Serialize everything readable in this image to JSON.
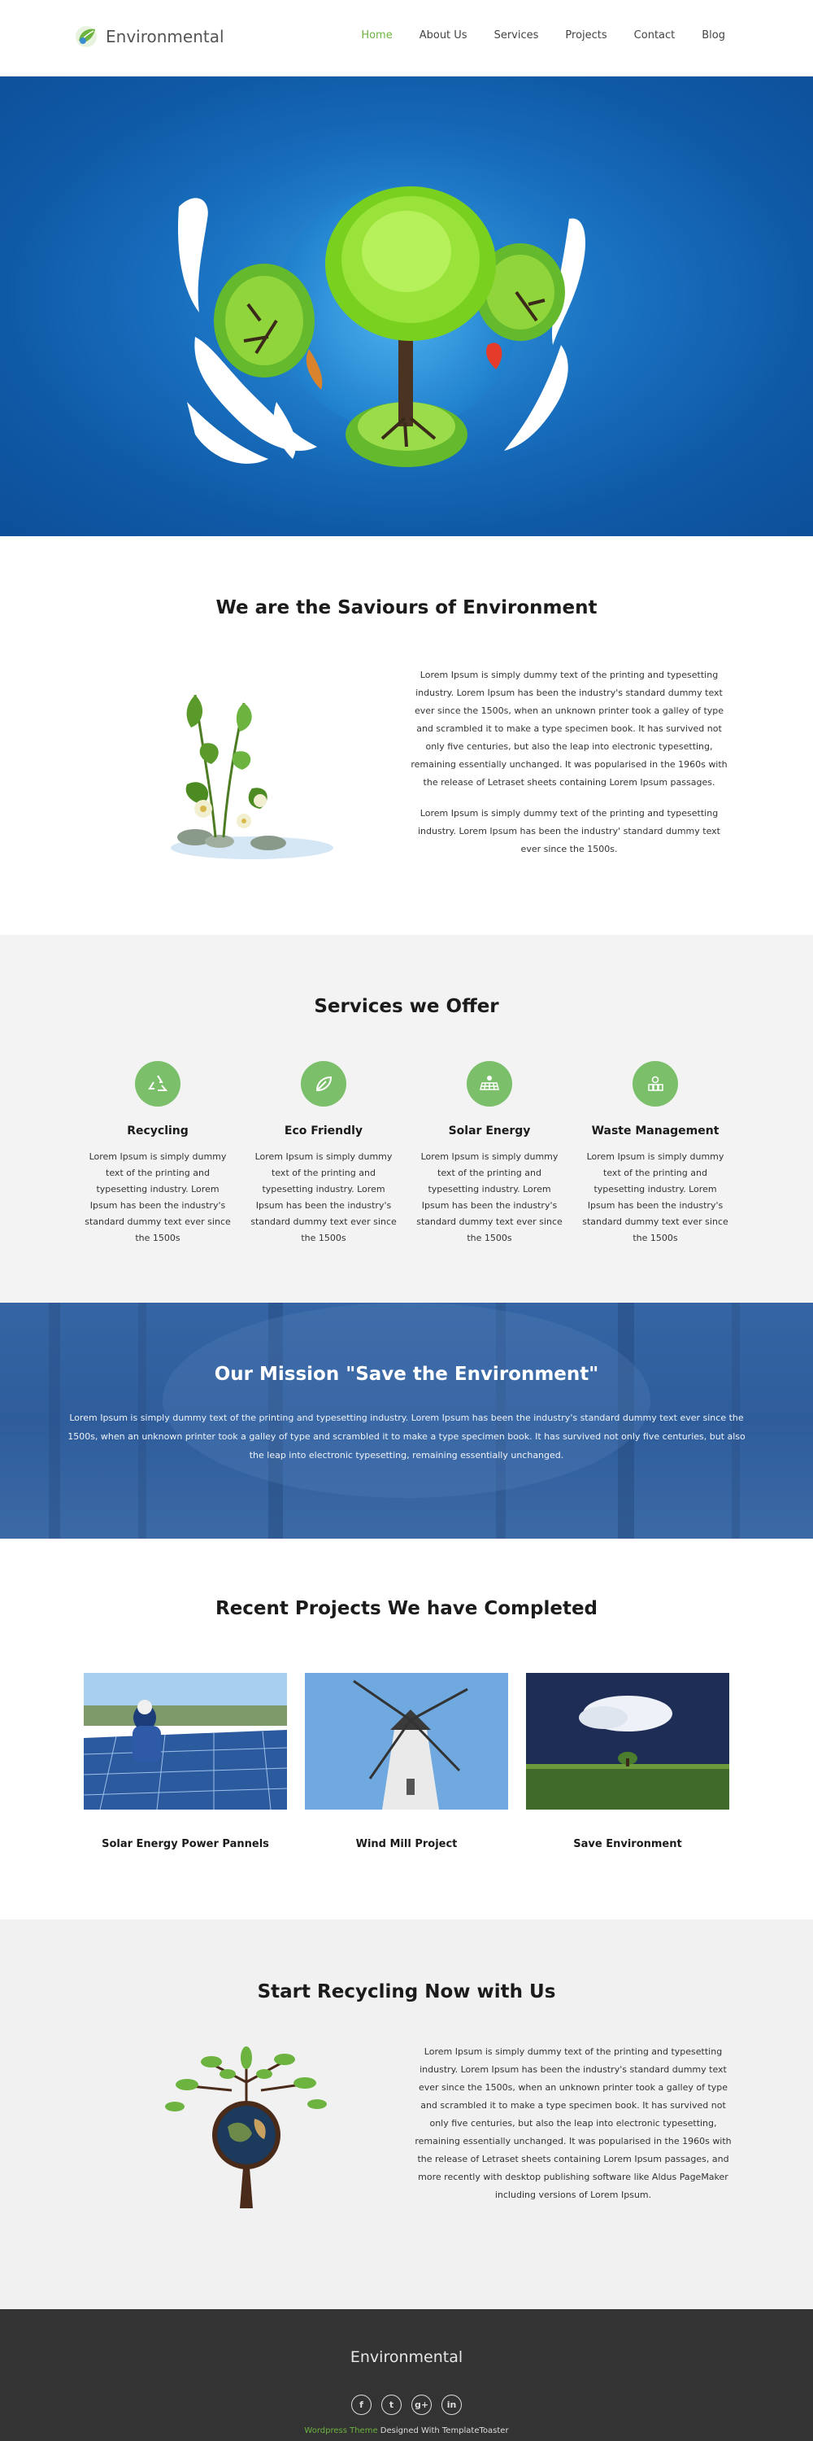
{
  "header": {
    "brand": "Environmental",
    "nav": [
      "Home",
      "About Us",
      "Services",
      "Projects",
      "Contact",
      "Blog"
    ],
    "active_index": 0
  },
  "about": {
    "title": "We are the Saviours of Environment",
    "paragraph1": "Lorem Ipsum is simply dummy text of the printing and typesetting industry. Lorem Ipsum has been the industry's standard dummy text ever since the 1500s, when an unknown printer took a galley of type and scrambled it to make a type specimen book. It has survived not only five centuries, but also the leap into electronic typesetting, remaining essentially unchanged. It was popularised in the 1960s with the release of Letraset sheets containing Lorem Ipsum passages.",
    "paragraph2": "Lorem Ipsum is simply dummy text of the printing and typesetting industry. Lorem Ipsum has been the industry' standard dummy text ever since the 1500s."
  },
  "services": {
    "title": "Services we Offer",
    "items": [
      {
        "title": "Recycling",
        "icon": "recycle-icon",
        "text": "Lorem Ipsum is simply dummy text of the printing and typesetting industry. Lorem Ipsum has been the industry's standard dummy text ever since the 1500s"
      },
      {
        "title": "Eco Friendly",
        "icon": "leaf-icon",
        "text": "Lorem Ipsum is simply dummy text of the printing and typesetting industry. Lorem Ipsum has been the industry's standard dummy text ever since the 1500s"
      },
      {
        "title": "Solar Energy",
        "icon": "solar-panel-icon",
        "text": "Lorem Ipsum is simply dummy text of the printing and typesetting industry. Lorem Ipsum has been the industry's standard dummy text ever since the 1500s"
      },
      {
        "title": "Waste Management",
        "icon": "waste-management-icon",
        "text": "Lorem Ipsum is simply dummy text of the printing and typesetting industry. Lorem Ipsum has been the industry's standard dummy text ever since the 1500s"
      }
    ]
  },
  "mission": {
    "title": "Our Mission \"Save the Environment\"",
    "text": "Lorem Ipsum is simply dummy text of the printing and typesetting industry. Lorem Ipsum has been the industry's standard dummy text ever since the 1500s, when an unknown printer took a galley of type and scrambled it to make a type specimen book. It has survived not only five centuries, but also the leap into electronic typesetting, remaining essentially unchanged."
  },
  "projects": {
    "title": "Recent Projects We have Completed",
    "items": [
      {
        "title": "Solar Energy Power Pannels"
      },
      {
        "title": "Wind Mill Project"
      },
      {
        "title": "Save Environment"
      }
    ]
  },
  "recycle": {
    "title": "Start Recycling Now with Us",
    "text": "Lorem Ipsum is simply dummy text of the printing and typesetting industry. Lorem Ipsum has been the industry's standard dummy text ever since the 1500s, when an unknown printer took a galley of type and scrambled it to make a type specimen book. It has survived not only five centuries, but also the leap into electronic typesetting, remaining essentially unchanged. It was popularised in the 1960s with the release of Letraset sheets containing Lorem Ipsum passages, and more recently with desktop publishing software like Aldus PageMaker including versions of Lorem Ipsum."
  },
  "footer": {
    "brand": "Environmental",
    "socials": [
      {
        "icon": "facebook-icon",
        "glyph": "f"
      },
      {
        "icon": "twitter-icon",
        "glyph": "t"
      },
      {
        "icon": "google-plus-icon",
        "glyph": "g+"
      },
      {
        "icon": "linkedin-icon",
        "glyph": "in"
      }
    ],
    "credit_link": "Wordpress Theme",
    "credit_text": " Designed With TemplateToaster"
  },
  "colors": {
    "accent": "#6cb33f",
    "service_icon_bg": "#7cbf6b",
    "hero_blue": "#1a73c2",
    "mission_blue": "#3565a4",
    "footer_bg": "#333333"
  }
}
